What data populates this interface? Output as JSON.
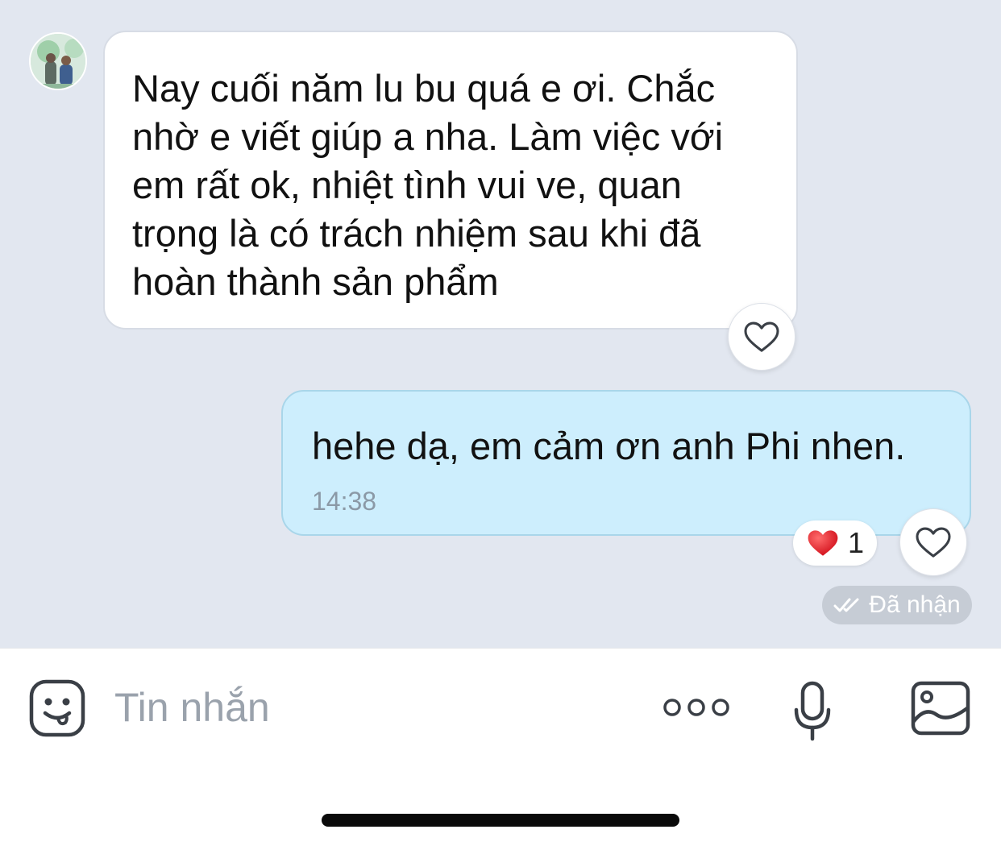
{
  "chat": {
    "incoming": {
      "text": "Nay cuối năm lu bu quá e ơi. Chắc nhờ e viết giúp a nha. Làm việc với em rất ok, nhiệt tình vui ve, quan trọng là có trách nhiệm sau khi đã hoàn thành sản phẩm"
    },
    "outgoing": {
      "text": "hehe dạ, em cảm ơn anh Phi nhen.",
      "time": "14:38",
      "reaction_emoji": "heart",
      "reaction_count": "1",
      "status": "Đã nhận"
    }
  },
  "composer": {
    "placeholder": "Tin nhắn"
  },
  "colors": {
    "chat_background": "#e2e7f0",
    "outgoing_bubble": "#cdeefd",
    "incoming_bubble": "#ffffff",
    "heart_red": "#e0202a"
  },
  "icons": {
    "reaction_button": "heart-outline-icon",
    "emoji": "emoji-face-icon",
    "more": "more-dots-icon",
    "mic": "microphone-icon",
    "image": "image-icon",
    "status": "double-check-icon"
  }
}
